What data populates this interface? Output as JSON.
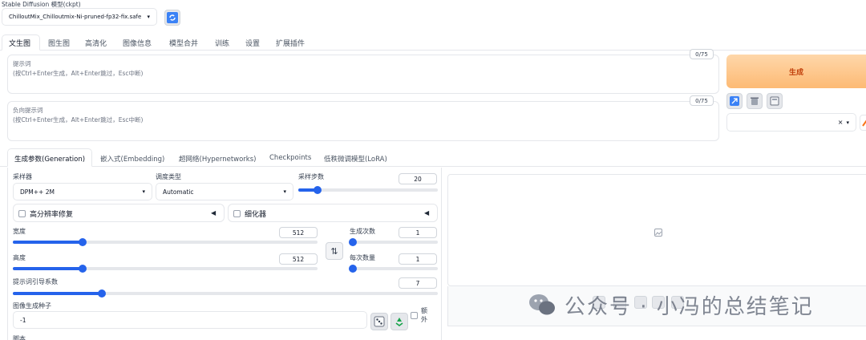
{
  "model": {
    "label": "Stable Diffusion 模型(ckpt)",
    "selected": "ChilloutMix_Chilloutmix-Ni-pruned-fp32-fix.safe",
    "refresh_icon": "refresh-icon"
  },
  "main_tabs": [
    "文生图",
    "图生图",
    "高清化",
    "图像信息",
    "模型合并",
    "训练",
    "设置",
    "扩展插件"
  ],
  "prompt": {
    "label": "提示词",
    "placeholder": "(按Ctrl+Enter生成，Alt+Enter跳过，Esc中断)",
    "counter": "0/75"
  },
  "negative": {
    "label": "负向提示词",
    "placeholder": "(按Ctrl+Enter生成，Alt+Enter跳过，Esc中断)",
    "counter": "0/75"
  },
  "generate": {
    "label": "生成"
  },
  "styles": {
    "clear": "×",
    "arrow": "▾"
  },
  "sub_tabs": [
    "生成参数(Generation)",
    "嵌入式(Embedding)",
    "超网络(Hypernetworks)",
    "Checkpoints",
    "低秩微调模型(LoRA)"
  ],
  "sampler": {
    "label": "采样器",
    "value": "DPM++ 2M"
  },
  "schedule": {
    "label": "调度类型",
    "value": "Automatic"
  },
  "steps": {
    "label": "采样步数",
    "value": "20",
    "fraction": 0.14
  },
  "hires": {
    "label": "高分辨率修复",
    "arrow": "◀"
  },
  "refiner": {
    "label": "细化器",
    "arrow": "◀"
  },
  "width": {
    "label": "宽度",
    "value": "512",
    "fraction": 0.23
  },
  "height": {
    "label": "高度",
    "value": "512",
    "fraction": 0.23
  },
  "swap": {
    "glyph": "⇅"
  },
  "batch_count": {
    "label": "生成次数",
    "value": "1",
    "fraction": 0.0
  },
  "batch_size": {
    "label": "每次数量",
    "value": "1",
    "fraction": 0.0
  },
  "cfg": {
    "label": "提示词引导系数",
    "value": "7",
    "fraction": 0.21
  },
  "seed": {
    "label": "图像生成种子",
    "value": "-1",
    "extra": "额外"
  },
  "script": {
    "label": "脚本"
  },
  "watermark": "公众号 · 小冯的总结笔记",
  "colors": {
    "accent": "#2563eb",
    "generate_from": "#fdba74",
    "generate_to": "#fb923c",
    "generate_text": "#c2410c"
  }
}
